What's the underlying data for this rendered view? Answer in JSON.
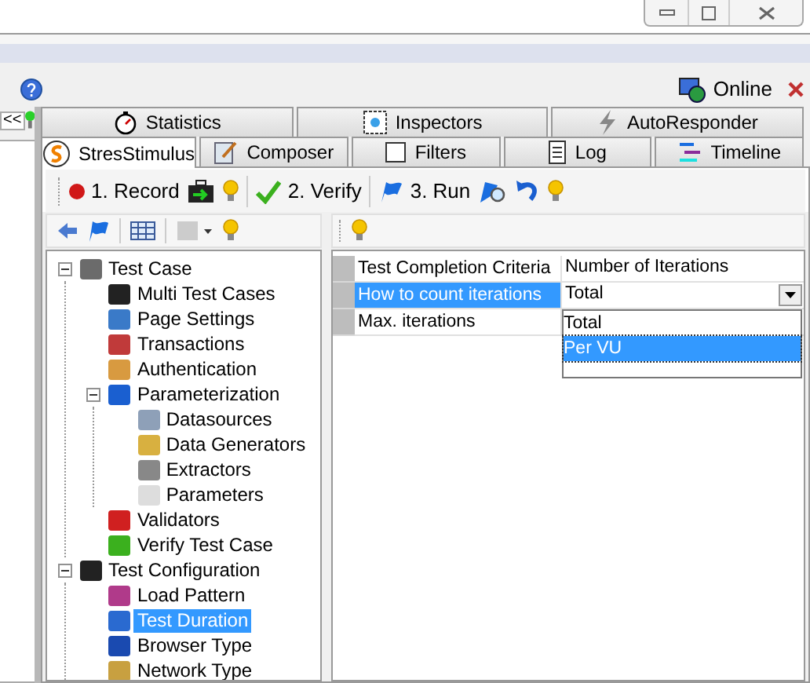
{
  "status": {
    "label": "Online"
  },
  "side_toggle": {
    "label": "<<"
  },
  "tab_rows": [
    [
      {
        "label": "Statistics",
        "selected": false
      },
      {
        "label": "Inspectors",
        "selected": false
      },
      {
        "label": "AutoResponder",
        "selected": false
      }
    ],
    [
      {
        "label": "StresStimulus",
        "selected": true
      },
      {
        "label": "Composer",
        "selected": false
      },
      {
        "label": "Filters",
        "selected": false
      },
      {
        "label": "Log",
        "selected": false
      },
      {
        "label": "Timeline",
        "selected": false
      }
    ]
  ],
  "toolbar": [
    {
      "kind": "record",
      "label": "1. Record"
    },
    {
      "kind": "case"
    },
    {
      "kind": "tip"
    },
    {
      "kind": "sep"
    },
    {
      "kind": "verify",
      "label": "2. Verify"
    },
    {
      "kind": "sep"
    },
    {
      "kind": "run",
      "label": "3. Run"
    },
    {
      "kind": "monitor"
    },
    {
      "kind": "undo"
    },
    {
      "kind": "tip"
    }
  ],
  "tree": [
    {
      "label": "Test Case",
      "expanded": true,
      "selected": false,
      "children": [
        {
          "label": "Multi Test Cases",
          "selected": false
        },
        {
          "label": "Page Settings",
          "selected": false
        },
        {
          "label": "Transactions",
          "selected": false
        },
        {
          "label": "Authentication",
          "selected": false
        },
        {
          "label": "Parameterization",
          "expanded": true,
          "selected": false,
          "children": [
            {
              "label": "Datasources",
              "selected": false
            },
            {
              "label": "Data Generators",
              "selected": false
            },
            {
              "label": "Extractors",
              "selected": false
            },
            {
              "label": "Parameters",
              "selected": false
            }
          ]
        },
        {
          "label": "Validators",
          "selected": false
        },
        {
          "label": "Verify Test Case",
          "selected": false
        }
      ]
    },
    {
      "label": "Test Configuration",
      "expanded": true,
      "selected": false,
      "children": [
        {
          "label": "Load Pattern",
          "selected": false
        },
        {
          "label": "Test Duration",
          "selected": true
        },
        {
          "label": "Browser Type",
          "selected": false
        },
        {
          "label": "Network Type",
          "selected": false
        }
      ]
    }
  ],
  "properties": [
    {
      "name": "Test Completion Criteria",
      "value": "Number of Iterations",
      "selected": false
    },
    {
      "name": "How to count iterations",
      "value": "Total",
      "selected": true
    },
    {
      "name": "Max. iterations",
      "selected": false
    }
  ],
  "dropdown": {
    "options": [
      {
        "label": "Total",
        "selected": false
      },
      {
        "label": "Per VU",
        "selected": true
      }
    ]
  }
}
